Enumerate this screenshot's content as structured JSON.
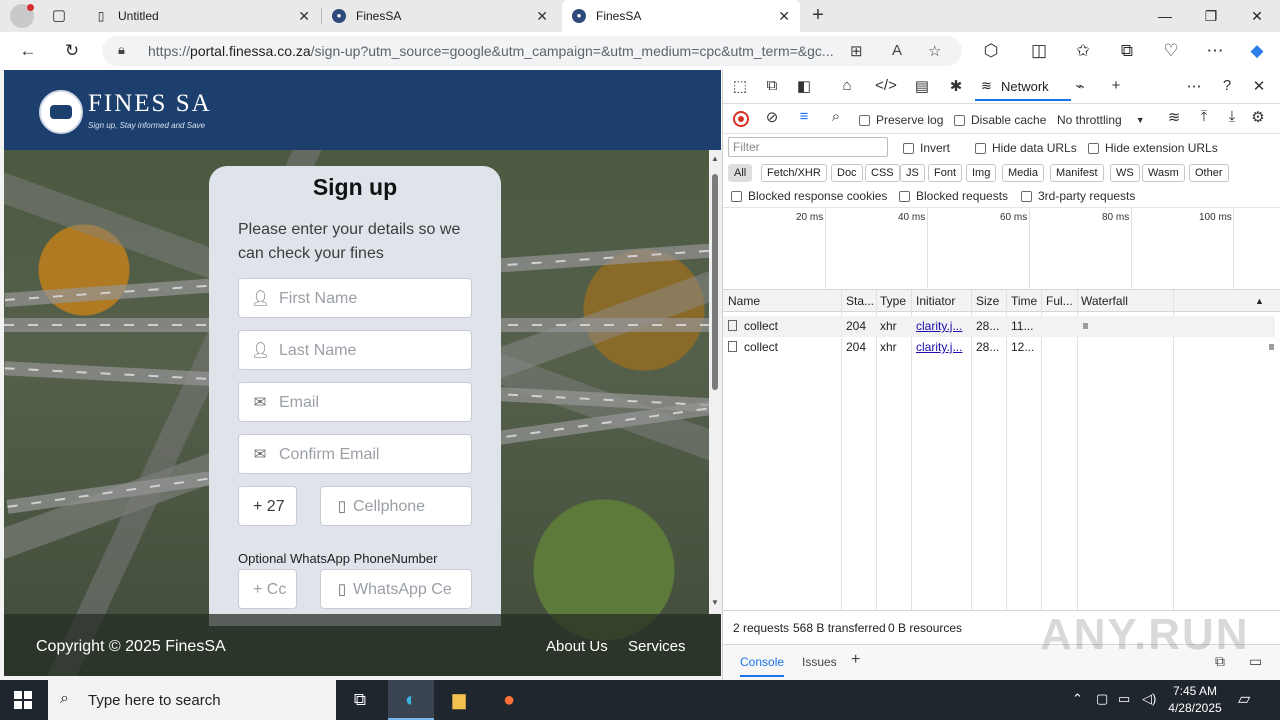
{
  "browser": {
    "tabs": [
      {
        "label": "Untitled",
        "icon": "page-icon"
      },
      {
        "label": "FinesSA",
        "icon": "site-favicon"
      },
      {
        "label": "FinesSA",
        "icon": "site-favicon",
        "active": true
      }
    ],
    "url_prefix": "https://",
    "url_host": "portal.finessa.co.za",
    "url_path": "/sign-up?utm_source=google&utm_campaign=&utm_medium=cpc&utm_term=&gc..."
  },
  "site": {
    "logo_text": "FINES SA",
    "tagline": "Sign up, Stay informed and Save",
    "form": {
      "title": "Sign up",
      "subtitle": "Please enter your details so we can check your fines",
      "first_name_placeholder": "First Name",
      "last_name_placeholder": "Last Name",
      "email_placeholder": "Email",
      "confirm_email_placeholder": "Confirm Email",
      "country_code": "+ 27",
      "cellphone_placeholder": "Cellphone",
      "whatsapp_label": "Optional WhatsApp PhoneNumber",
      "whatsapp_code_placeholder": "+ Cc",
      "whatsapp_placeholder": "WhatsApp Ce"
    },
    "footer": {
      "copyright": "Copyright © 2025 FinesSA",
      "links": [
        "About Us",
        "Services"
      ]
    },
    "colors": {
      "header_bg": "#1c3f6e",
      "card_bg": "#dfe3ea"
    }
  },
  "devtools": {
    "active_panel": "Network",
    "preserve_log": "Preserve log",
    "disable_cache": "Disable cache",
    "throttling": "No throttling",
    "filter_placeholder": "Filter",
    "invert": "Invert",
    "hide_data_urls": "Hide data URLs",
    "hide_extension_urls": "Hide extension URLs",
    "type_filters": [
      "All",
      "Fetch/XHR",
      "Doc",
      "CSS",
      "JS",
      "Font",
      "Img",
      "Media",
      "Manifest",
      "WS",
      "Wasm",
      "Other"
    ],
    "blocked_cookies": "Blocked response cookies",
    "blocked_requests": "Blocked requests",
    "third_party": "3rd-party requests",
    "timeline_ticks": [
      "20 ms",
      "40 ms",
      "60 ms",
      "80 ms",
      "100 ms"
    ],
    "columns": [
      "Name",
      "Sta...",
      "Type",
      "Initiator",
      "Size",
      "Time",
      "Ful...",
      "Waterfall"
    ],
    "rows": [
      {
        "name": "collect",
        "status": "204",
        "type": "xhr",
        "initiator": "clarity.j...",
        "size": "28...",
        "time": "11..."
      },
      {
        "name": "collect",
        "status": "204",
        "type": "xhr",
        "initiator": "clarity.j...",
        "size": "28...",
        "time": "12..."
      }
    ],
    "summary": {
      "requests": "2 requests",
      "transferred": "568 B transferred",
      "resources": "0 B resources"
    },
    "drawer_tabs": [
      "Console",
      "Issues"
    ]
  },
  "watermark": "ANY.RUN",
  "taskbar": {
    "search_placeholder": "Type here to search",
    "time": "7:45 AM",
    "date": "4/28/2025"
  }
}
